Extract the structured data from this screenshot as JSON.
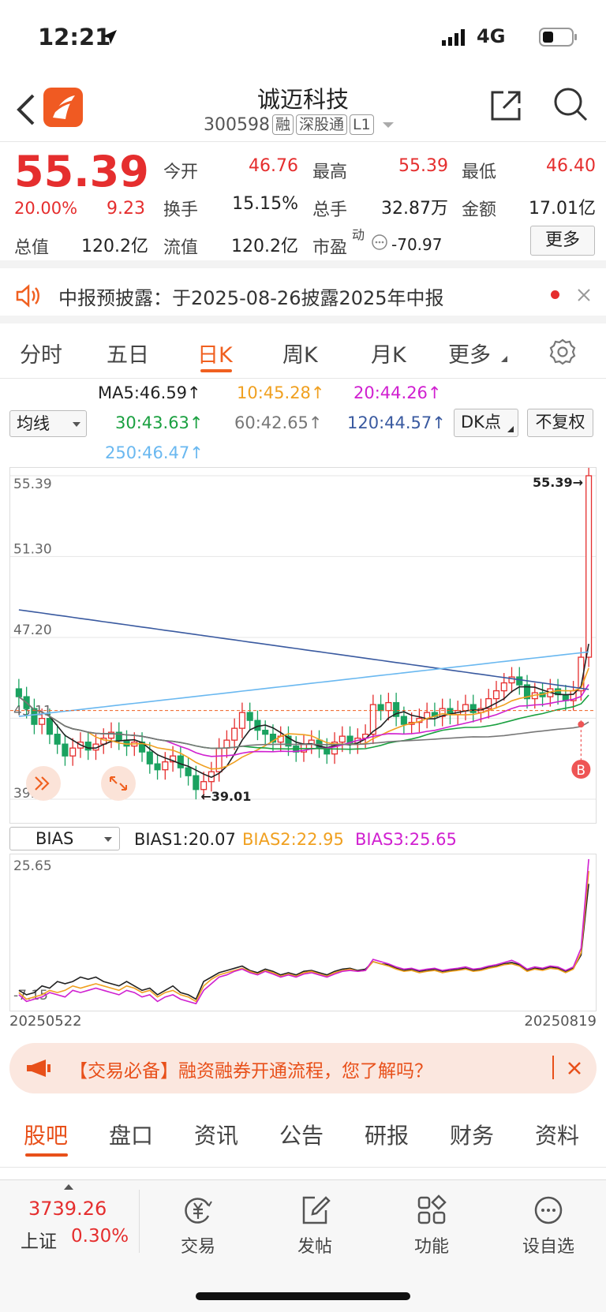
{
  "status": {
    "time": "12:21",
    "network": "4G"
  },
  "header": {
    "title": "诚迈科技",
    "code": "300598",
    "tags": [
      "融",
      "深股通",
      "L1"
    ]
  },
  "quote": {
    "price": "55.39",
    "pct": "20.00%",
    "chg": "9.23",
    "labels": {
      "open": "今开",
      "high": "最高",
      "low": "最低",
      "turnover": "换手",
      "volume": "总手",
      "amount": "金额",
      "mktcap": "总值",
      "float": "流值",
      "pe": "市盈",
      "pe_sup": "动"
    },
    "values": {
      "open": "46.76",
      "high": "55.39",
      "low": "46.40",
      "turnover": "15.15%",
      "volume": "32.87万",
      "amount": "17.01亿",
      "mktcap": "120.2亿",
      "float": "120.2亿",
      "pe": "-70.97"
    },
    "more": "更多"
  },
  "notice": {
    "text": "中报预披露：于2025-08-26披露2025年中报"
  },
  "tabs": [
    "分时",
    "五日",
    "日K",
    "周K",
    "月K",
    "更多"
  ],
  "ma": {
    "selector": "均线",
    "dk": "DK点",
    "fq": "不复权",
    "ma5": "MA5:46.59↑",
    "ma10": "10:45.28↑",
    "ma20": "20:44.26↑",
    "ma30": "30:43.63↑",
    "ma60": "60:42.65↑",
    "ma120": "120:44.57↑",
    "ma250": "250:46.47↑",
    "colors": {
      "ma5": "#222222",
      "ma10": "#f0a020",
      "ma20": "#d020d0",
      "ma30": "#1aa040",
      "ma60": "#777777",
      "ma120": "#3a5aa0",
      "ma250": "#6ab8f0"
    }
  },
  "chart_data": [
    {
      "type": "candlestick",
      "title": "",
      "yticks": [
        "55.39",
        "51.30",
        "47.20",
        "43.11",
        "39.01"
      ],
      "ylim": [
        39.01,
        55.39
      ],
      "max_label": "55.39→",
      "min_label": "←39.01",
      "marker": "B",
      "x_start": "20250522",
      "x_end": "20250819",
      "closes": [
        44.2,
        43.6,
        42.8,
        43.1,
        42.3,
        41.8,
        41.2,
        41.6,
        41.9,
        41.5,
        41.8,
        42.1,
        42.4,
        42.0,
        41.7,
        41.9,
        41.4,
        40.8,
        40.5,
        40.9,
        41.2,
        40.6,
        40.2,
        39.5,
        39.9,
        40.4,
        41.6,
        42.0,
        42.6,
        43.4,
        43.0,
        42.5,
        42.3,
        41.9,
        42.2,
        41.7,
        41.4,
        41.8,
        42.0,
        41.6,
        41.3,
        41.9,
        42.2,
        41.8,
        42.1,
        42.3,
        43.8,
        43.5,
        43.9,
        43.2,
        42.8,
        42.9,
        43.1,
        43.4,
        43.2,
        43.6,
        43.3,
        43.5,
        43.8,
        43.4,
        43.6,
        44.1,
        44.5,
        44.9,
        45.2,
        44.8,
        44.1,
        44.4,
        44.2,
        44.6,
        44.3,
        44.0,
        44.5,
        46.2,
        55.39
      ],
      "series": [
        {
          "name": "BIAS1",
          "value": "BIAS1:20.07"
        },
        {
          "name": "BIAS2",
          "value": "BIAS2:22.95"
        },
        {
          "name": "BIAS3",
          "value": "BIAS3:25.65"
        }
      ]
    },
    {
      "type": "line",
      "selector": "BIAS",
      "yticks": [
        "25.65",
        "-7.15"
      ],
      "ylim": [
        -7.15,
        25.65
      ],
      "bias1": [
        -4,
        -5,
        -4.5,
        -3,
        -3.5,
        -2,
        -2.5,
        -2,
        -1,
        -1.5,
        -1,
        -2,
        -2.5,
        -3,
        -2,
        -3,
        -4,
        -3.5,
        -5,
        -4,
        -3,
        -4.5,
        -5,
        -6,
        -2,
        -1,
        0,
        0.5,
        1,
        1.5,
        0.5,
        0,
        0.8,
        0.3,
        -0.5,
        0,
        -0.5,
        0.3,
        0.5,
        0,
        -0.5,
        0.3,
        0.8,
        1,
        0.5,
        0.8,
        2.5,
        2,
        1.8,
        1,
        0.5,
        0.8,
        0.3,
        0.5,
        0.8,
        0.3,
        0.5,
        0.8,
        1,
        0.5,
        0.8,
        1.2,
        1.5,
        2,
        2.3,
        1.8,
        0.5,
        1,
        0.8,
        1.3,
        1,
        0.3,
        1,
        4,
        20.07
      ],
      "bias2": [
        -4.5,
        -6,
        -5.5,
        -5,
        -4,
        -4.5,
        -4,
        -3,
        -3.5,
        -3,
        -2.5,
        -3,
        -3.5,
        -4,
        -3,
        -3.5,
        -4.5,
        -4,
        -5.5,
        -4.5,
        -4,
        -5,
        -5.5,
        -6.5,
        -3,
        -1.5,
        -0.5,
        0,
        0.5,
        1,
        0.3,
        -0.3,
        0.5,
        0,
        -0.8,
        -0.3,
        -0.8,
        0,
        0.3,
        -0.3,
        -0.8,
        0,
        0.5,
        0.8,
        0.3,
        0.5,
        2.5,
        2,
        1.5,
        0.8,
        0.3,
        0.5,
        0,
        0.3,
        0.5,
        0,
        0.3,
        0.5,
        0.8,
        0.3,
        0.5,
        1,
        1.3,
        1.8,
        2,
        1.5,
        0.3,
        0.8,
        0.5,
        1,
        0.8,
        0,
        0.8,
        4.5,
        22.95
      ],
      "bias3": [
        -5,
        -6.5,
        -6,
        -5.5,
        -4.5,
        -5,
        -5.5,
        -4,
        -4.5,
        -4,
        -3.5,
        -4,
        -4.5,
        -5,
        -4,
        -4.5,
        -5.5,
        -5,
        -6.5,
        -5.5,
        -5,
        -6,
        -6.5,
        -7,
        -4,
        -2.5,
        -1,
        -0.5,
        0.3,
        0.8,
        0,
        -0.5,
        0.3,
        -0.3,
        -1,
        -0.5,
        -1,
        -0.3,
        0,
        -0.5,
        -1,
        -0.3,
        0.3,
        0.5,
        0.3,
        0.5,
        3,
        2.5,
        2,
        1.3,
        0.8,
        1,
        0.5,
        0.8,
        1,
        0.5,
        0.8,
        1,
        1.3,
        0.8,
        1,
        1.5,
        1.8,
        2.3,
        2.8,
        2,
        0.8,
        1.3,
        1,
        1.5,
        1.3,
        0.5,
        1.3,
        5.5,
        25.65
      ]
    }
  ],
  "ad": {
    "text": "【交易必备】融资融券开通流程，您了解吗？"
  },
  "bottom_tabs": [
    "股吧",
    "盘口",
    "资讯",
    "公告",
    "研报",
    "财务",
    "资料"
  ],
  "dock": {
    "index_value": "3739.26",
    "index_name": "上证",
    "index_pct": "0.30%",
    "items": [
      "交易",
      "发帖",
      "功能",
      "设自选"
    ]
  }
}
